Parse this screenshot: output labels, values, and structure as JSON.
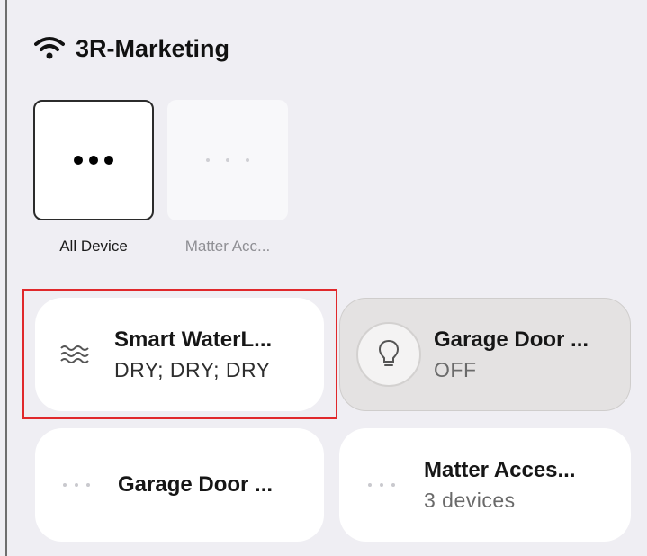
{
  "header": {
    "title": "3R-Marketing",
    "icon": "wifi-icon"
  },
  "categories": [
    {
      "label": "All Device",
      "selected": true
    },
    {
      "label": "Matter Acc...",
      "selected": false
    }
  ],
  "devices": [
    {
      "name": "Smart WaterL...",
      "status": "DRY; DRY; DRY",
      "icon": "water-waves-icon",
      "highlighted": true
    },
    {
      "name": "Garage Door ...",
      "status": "OFF",
      "icon": "lightbulb-icon",
      "state": "off"
    },
    {
      "name": "Garage Door ...",
      "status": "",
      "icon": "dots-icon"
    },
    {
      "name": "Matter Acces...",
      "status": "3 devices",
      "icon": "dots-icon"
    }
  ],
  "colors": {
    "highlight": "#e0282b",
    "background": "#efeef3",
    "off_card": "#e4e2e2"
  }
}
